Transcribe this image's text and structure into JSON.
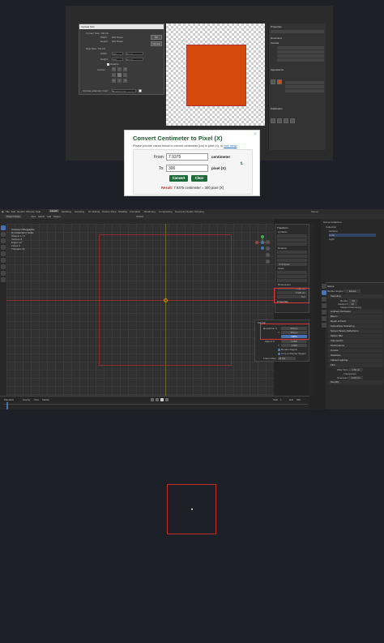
{
  "photoshop": {
    "canvas_size_dialog": {
      "title": "Canvas Size",
      "current_size_label": "Current Size: 732.2K",
      "width_label": "Width:",
      "width_value": "300 Pixels",
      "height_label": "Height:",
      "height_value": "300 Pixels",
      "new_size_label": "New Size: 732.2K",
      "new_width_value": "300",
      "new_height_value": "300",
      "unit_select": "Pixels",
      "relative_label": "Relative",
      "anchor_label": "Anchor:",
      "extension_color_label": "Canvas extension color:",
      "extension_color_value": "Background",
      "ok_label": "OK",
      "cancel_label": "Cancel"
    },
    "properties_panel": {
      "title": "Properties",
      "document_label": "Document",
      "canvas_label": "Canvas",
      "appearance_label": "Appearance",
      "publication_label": "Publication"
    }
  },
  "converter": {
    "title": "Convert Centimeter to Pixel (X)",
    "subtitle": "Please provide values below to convert centimeter [cm] to pixel (X), or",
    "vice_versa": "vice versa",
    "from_label": "From:",
    "from_value": "7.9375",
    "from_unit": "centimeter",
    "to_label": "To:",
    "to_value": "300",
    "to_unit": "pixel (X)",
    "convert_label": "Convert",
    "clear_label": "Clear",
    "result_label": "Result:",
    "result_text": "7.9375 centimeter = 300 pixel (X)"
  },
  "blender": {
    "menus": [
      "File",
      "Edit",
      "Render",
      "Window",
      "Help"
    ],
    "workspace_tabs": [
      "Layout",
      "Modeling",
      "Sculpting",
      "UV Editing",
      "Texture Paint",
      "Shading",
      "Animation",
      "Rendering",
      "Compositing",
      "Geometry Nodes",
      "Scripting"
    ],
    "mode": "Object Mode",
    "view_menus": [
      "View",
      "Select",
      "Add",
      "Object"
    ],
    "transform_orientation": "Global",
    "overlay_info": {
      "camera": "Camera Orthographic",
      "collection": "(1) Collection | Cube",
      "stats": [
        [
          "Objects",
          "1 / 3"
        ],
        [
          "Vertices",
          "8"
        ],
        [
          "Edges",
          "12"
        ],
        [
          "Faces",
          "6"
        ],
        [
          "Triangles",
          "12"
        ]
      ]
    },
    "n_panel": {
      "transform": "Transform",
      "location": "Location",
      "rotation": "Rotation",
      "scale": "Scale",
      "dimensions": "Dimensions",
      "rotation_mode": "XYZ Euler",
      "dimension_values": [
        "7.940 cm",
        "7.940 cm",
        "0 m"
      ],
      "properties": "Properties"
    },
    "format_panel": {
      "title": "Format",
      "resolution_x_label": "Resolution X",
      "resolution_x": "300 px",
      "resolution_y_label": "Y",
      "resolution_y": "300 px",
      "percent": "100%",
      "aspect_x_label": "Aspect X",
      "aspect_x": "1.000",
      "aspect_y_label": "Y",
      "aspect_y": "1.000",
      "render_region": "Render Region",
      "crop_label": "Crop to Render Region",
      "frame_rate_label": "Frame Rate",
      "frame_rate": "24 fps"
    },
    "outliner": {
      "scene_collection": "Scene Collection",
      "collection": "Collection",
      "items": [
        "Camera",
        "Cube",
        "Light"
      ]
    },
    "properties": {
      "scene": "Scene",
      "render_engine_label": "Render Engine",
      "render_engine": "Eevee",
      "sampling": "Sampling",
      "render_label": "Render",
      "render_value": "64",
      "viewport_label": "Viewport",
      "viewport_value": "16",
      "viewport_denoising": "Viewport Denoising",
      "sections": [
        "Ambient Occlusion",
        "Bloom",
        "Depth of Field",
        "Subsurface Scattering",
        "Screen Space Reflections",
        "Motion Blur",
        "Volumetrics",
        "Performance",
        "Curves",
        "Shadows",
        "Indirect Lighting"
      ],
      "film": "Film",
      "filter_size_label": "Filter Size",
      "filter_size": "1.50 px",
      "transparent": "Transparent",
      "overscan": "Overscan",
      "overscan_value": "3.00 cm",
      "simplify": "Simplify"
    },
    "timeline": {
      "playback": "Playback",
      "keying": "Keying",
      "view": "View",
      "marker": "Marker",
      "start_label": "Start",
      "start": "1",
      "end_label": "End",
      "end": "250"
    }
  },
  "colors": {
    "ps_orange": "#d44a0e",
    "converter_green": "#1d6b3a",
    "result_red": "#c0281b",
    "highlight_red": "#d33333",
    "blender_blue": "#4772b3"
  }
}
